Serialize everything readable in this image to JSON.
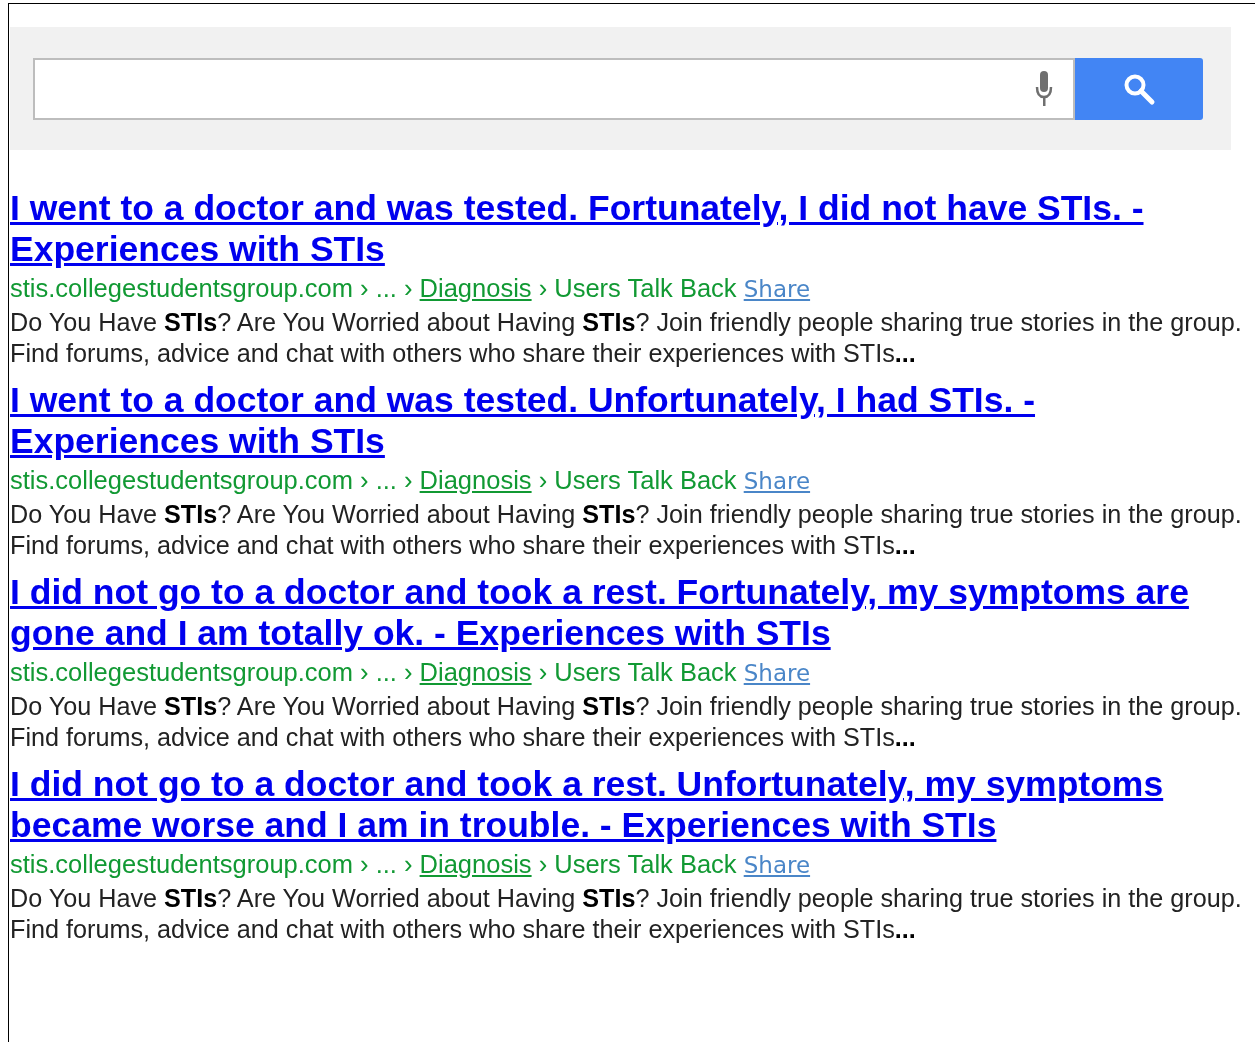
{
  "results": [
    {
      "title": "I went to a doctor and was tested. Fortunately, I did not have STIs. - Experiences with STIs",
      "site": "stis.collegestudentsgroup.com › ... ›",
      "crumb_link": "Diagnosis",
      "crumb_rest": "› Users Talk Back",
      "share": "Share",
      "snippet": "Do You Have **STIs**? Are You Worried about Having **STIs**? Join friendly people sharing true stories in the group. Find forums, advice and chat with others who share their experiences with STIs**...**"
    },
    {
      "title": "I went to a doctor and was tested. Unfortunately, I had STIs. - Experiences with STIs",
      "site": "stis.collegestudentsgroup.com › ... ›",
      "crumb_link": "Diagnosis",
      "crumb_rest": "› Users Talk Back",
      "share": "Share",
      "snippet": "Do You Have **STIs**? Are You Worried about Having **STIs**? Join friendly people sharing true stories in the group. Find forums, advice and chat with others who share their experiences with STIs**...**"
    },
    {
      "title": "I did not go to a doctor and took a rest. Fortunately, my symptoms are gone and I am totally ok. - Experiences with STIs",
      "site": "stis.collegestudentsgroup.com › ... ›",
      "crumb_link": "Diagnosis",
      "crumb_rest": "› Users Talk Back",
      "share": "Share",
      "snippet": "Do You Have **STIs**? Are You Worried about Having **STIs**? Join friendly people sharing true stories in the group. Find forums, advice and chat with others who share their experiences with STIs**...**"
    },
    {
      "title": "I did not go to a doctor and took a rest. Unfortunately, my symptoms became worse and I am in trouble. - Experiences with STIs",
      "site": "stis.collegestudentsgroup.com › ... ›",
      "crumb_link": "Diagnosis",
      "crumb_rest": "› Users Talk Back",
      "share": "Share",
      "snippet": "Do You Have **STIs**? Are You Worried about Having **STIs**? Join friendly people sharing true stories in the group. Find forums, advice and chat with others who share their experiences with STIs**...**"
    }
  ]
}
